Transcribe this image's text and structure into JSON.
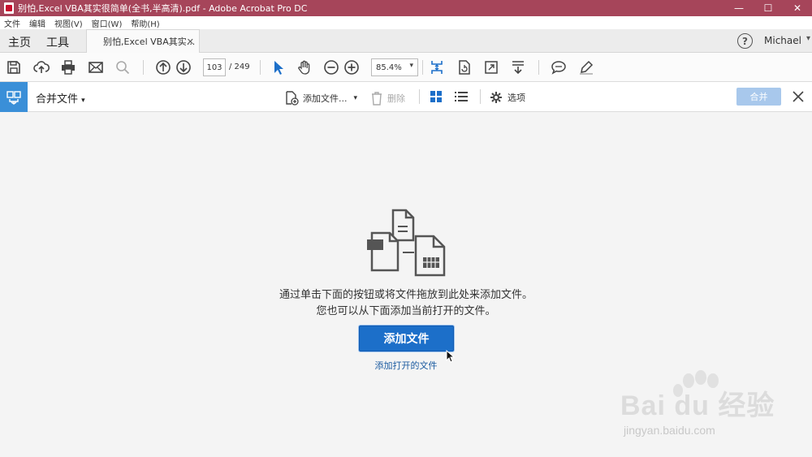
{
  "window": {
    "title": "别怕,Excel VBA其实很简单(全书,半高清).pdf - Adobe Acrobat Pro DC",
    "controls": {
      "minimize": "—",
      "maximize": "☐",
      "close": "✕"
    }
  },
  "menu": {
    "items": [
      "文件",
      "编辑",
      "视图(V)",
      "窗口(W)",
      "帮助(H)"
    ]
  },
  "tabs": {
    "home": "主页",
    "tools": "工具",
    "document": "别怕,Excel VBA其实...",
    "close_glyph": "✕",
    "help_glyph": "?",
    "user": "Michael"
  },
  "toolbar": {
    "page_current": "103",
    "page_total": "/ 249",
    "zoom": "85.4%"
  },
  "combine": {
    "title": "合并文件",
    "add_files": "添加文件...",
    "delete": "删除",
    "options": "选项",
    "merge": "合并"
  },
  "main": {
    "line1": "通过单击下面的按钮或将文件拖放到此处来添加文件。",
    "line2": "您也可以从下面添加当前打开的文件。",
    "add_button": "添加文件",
    "add_open_link": "添加打开的文件"
  },
  "watermark": {
    "brand": "Bai du 经验",
    "url": "jingyan.baidu.com"
  },
  "colors": {
    "titlebar": "#a6455a",
    "accent": "#1c6fc9",
    "merge_disabled": "#a8c8ec"
  }
}
